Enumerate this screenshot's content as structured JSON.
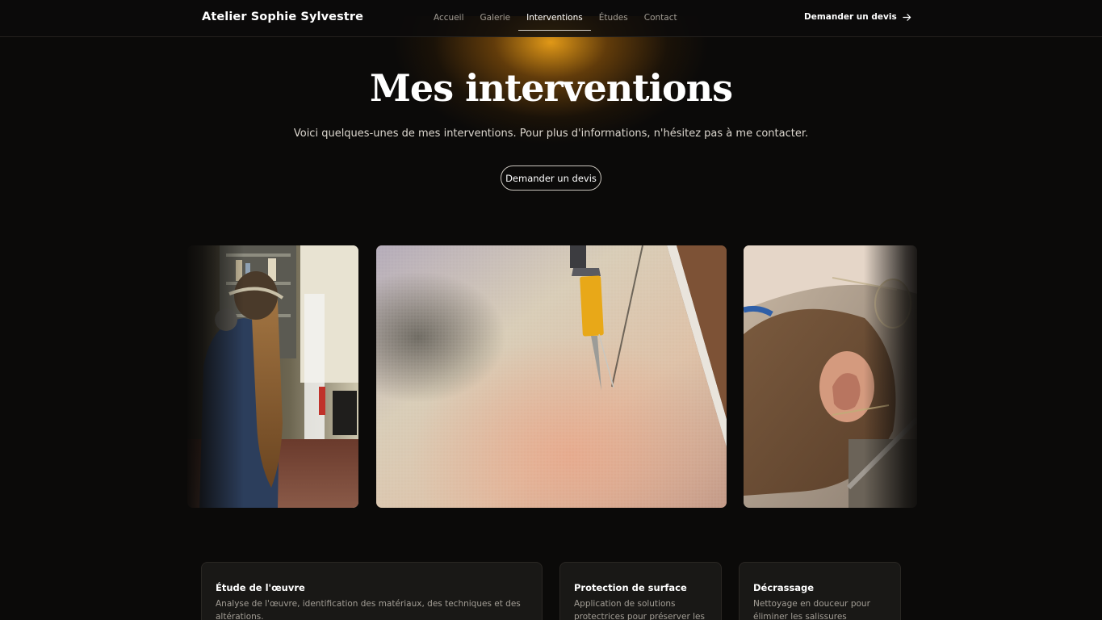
{
  "header": {
    "brand": "Atelier Sophie Sylvestre",
    "nav": [
      "Accueil",
      "Galerie",
      "Interventions",
      "Études",
      "Contact"
    ],
    "active_nav": "Interventions",
    "cta_label": "Demander un devis"
  },
  "hero": {
    "title": "Mes interventions",
    "subtitle": "Voici quelques-unes de mes interventions. Pour plus d'informations, n'hésitez pas à me contacter.",
    "cta_label": "Demander un devis"
  },
  "carousel": {
    "slides": [
      "restorer-wearing-respirator-photo",
      "syringe-on-canvas-photo",
      "restorer-close-work-photo"
    ]
  },
  "services": [
    {
      "title": "Étude de l'œuvre",
      "description": "Analyse de l'œuvre, identification des matériaux, des techniques et des altérations."
    },
    {
      "title": "Protection de surface",
      "description": "Application de solutions protectrices pour préserver les"
    },
    {
      "title": "Décrassage",
      "description": "Nettoyage en douceur pour éliminer les salissures"
    }
  ],
  "colors": {
    "background": "#0b0a09",
    "glow": "#eca018",
    "card_background": "#191816",
    "muted_text": "#a39e96"
  }
}
